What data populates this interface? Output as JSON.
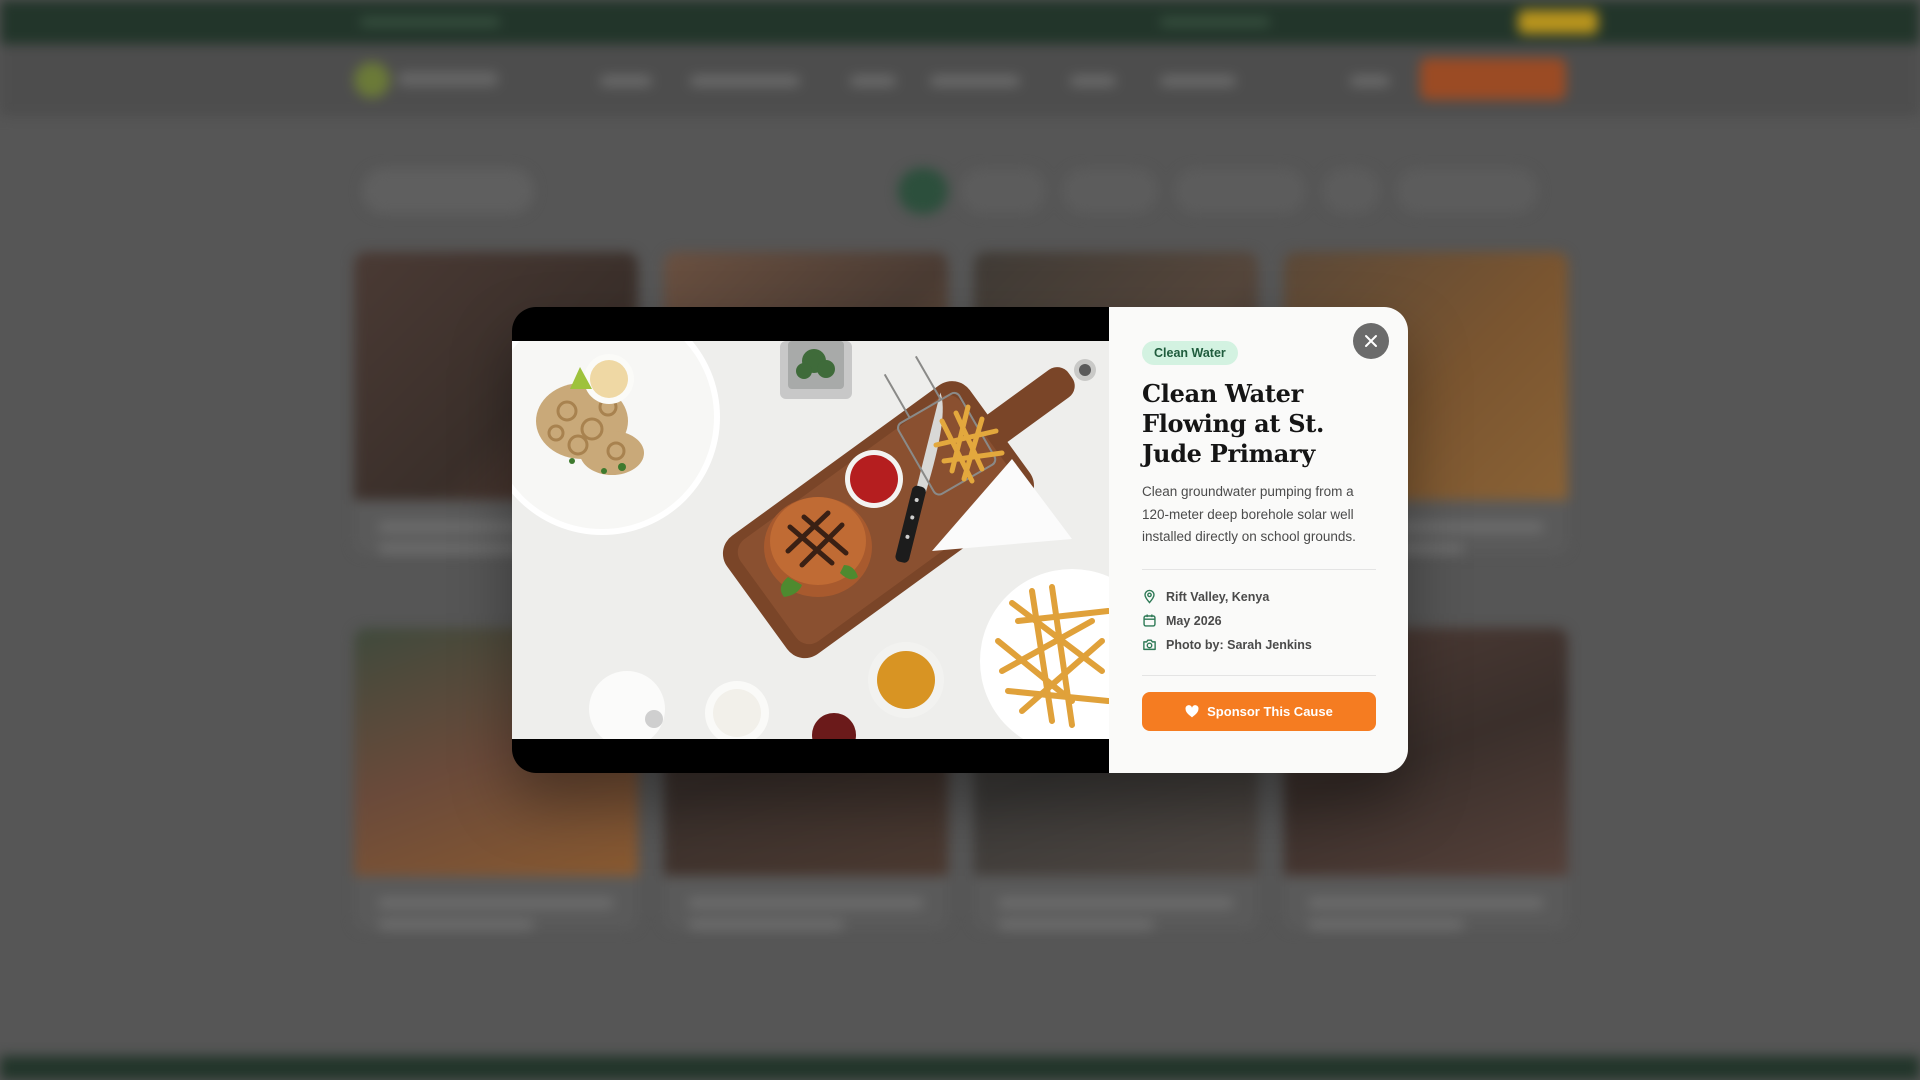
{
  "modal": {
    "category_badge": "Clean Water",
    "title": "Clean Water Flowing at St. Jude Primary",
    "description": "Clean groundwater pumping from a 120-meter deep borehole solar well installed directly on school grounds.",
    "location": "Rift Valley, Kenya",
    "date": "May 2026",
    "photo_credit": "Photo by: Sarah Jenkins",
    "sponsor_label": "Sponsor This Cause",
    "close_icon": "close-icon",
    "photo_subject": "overhead food: burger on wooden board, fries, calamari, sauces"
  },
  "colors": {
    "accent_orange": "#f57c21",
    "badge_bg": "#d3f2e1",
    "badge_text": "#1f5c3d",
    "icon_green": "#2f7a57",
    "topbar_green": "#22352a",
    "backdrop": "#565656"
  }
}
